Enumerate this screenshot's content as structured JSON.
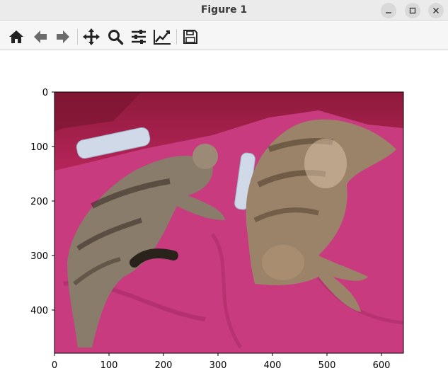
{
  "window": {
    "title": "Figure 1"
  },
  "toolbar": {
    "buttons": [
      {
        "name": "home",
        "icon": "home-icon"
      },
      {
        "name": "back",
        "icon": "arrow-left-icon"
      },
      {
        "name": "forward",
        "icon": "arrow-right-icon"
      },
      {
        "name": "pan",
        "icon": "move-icon"
      },
      {
        "name": "zoom",
        "icon": "zoom-icon"
      },
      {
        "name": "configure-subplots",
        "icon": "sliders-icon"
      },
      {
        "name": "edit-axes",
        "icon": "line-chart-icon"
      },
      {
        "name": "save",
        "icon": "floppy-disk-icon"
      }
    ]
  },
  "plot": {
    "image_description": "photo",
    "x_ticks": [
      "0",
      "100",
      "200",
      "300",
      "400",
      "500",
      "600"
    ],
    "y_ticks": [
      "0",
      "100",
      "200",
      "300",
      "400"
    ],
    "colors": {
      "blanket": "#c83b7f",
      "axis": "#000000"
    }
  }
}
